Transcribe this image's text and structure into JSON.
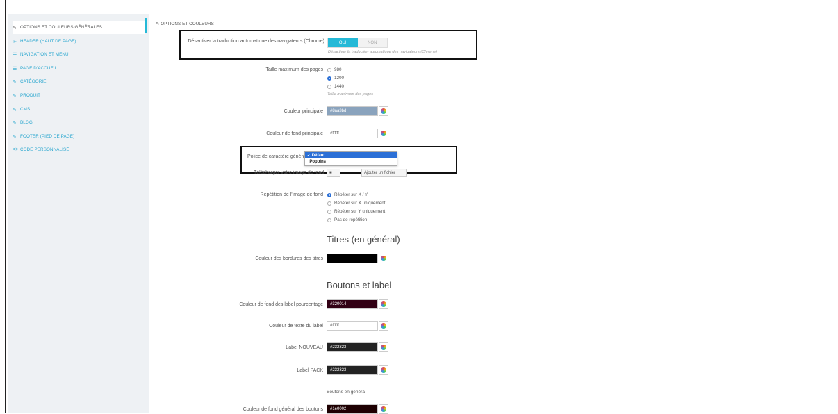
{
  "sidebar": {
    "items": [
      {
        "icon": "pencil-icon",
        "glyph": "✎",
        "label": "OPTIONS ET COULEURS GÉNÉRALES"
      },
      {
        "icon": "header-icon",
        "glyph": "⊩",
        "label": "HEADER (HAUT DE PAGE)"
      },
      {
        "icon": "menu-icon",
        "glyph": "☰",
        "label": "NAVIGATION ET MENU"
      },
      {
        "icon": "menu-icon",
        "glyph": "☰",
        "label": "PAGE D'ACCUEIL"
      },
      {
        "icon": "pencil-icon",
        "glyph": "✎",
        "label": "CATÉGORIE"
      },
      {
        "icon": "pencil-icon",
        "glyph": "✎",
        "label": "PRODUIT"
      },
      {
        "icon": "pencil-icon",
        "glyph": "✎",
        "label": "CMS"
      },
      {
        "icon": "pencil-icon",
        "glyph": "✎",
        "label": "BLOG"
      },
      {
        "icon": "pencil-icon",
        "glyph": "✎",
        "label": "FOOTER (PIED DE PAGE)"
      },
      {
        "icon": "code-icon",
        "glyph": "<>",
        "label": "CODE PERSONNALISÉ"
      }
    ]
  },
  "panel": {
    "header_icon": "✎",
    "header": "OPTIONS ET COULEURS"
  },
  "form": {
    "translation": {
      "label": "Désactiver la traduction automatique des navigateurs (Chrome)",
      "yes": "OUI",
      "no": "NON",
      "help": "Désactiver la traduction automatique des navigateurs (Chrome)"
    },
    "page_size": {
      "label": "Taille maximum des pages",
      "options": [
        "980",
        "1200",
        "1440"
      ],
      "help": "Taille maximum des pages"
    },
    "main_color": {
      "label": "Couleur principale",
      "value": "#8aa3bd"
    },
    "main_bg_color": {
      "label": "Couleur de fond principale",
      "value": "#ffffff"
    },
    "font": {
      "label": "Police de caractère générale du site",
      "options": [
        "Défaut",
        "Poppins"
      ],
      "checkmark": "✓"
    },
    "bg_image": {
      "label": "Télécharger votre image de fond",
      "add_label": "Ajouter un fichier"
    },
    "bg_repeat": {
      "label": "Répétition de l'image de fond",
      "options": [
        "Répéter sur X / Y",
        "Répéter sur X uniquement",
        "Répéter sur Y uniquement",
        "Pas de répétition"
      ]
    },
    "titles_section": "Titres (en général)",
    "title_border_color": {
      "label": "Couleur des bordures des titres",
      "value": ""
    },
    "buttons_section": "Boutons et label",
    "label_pct_bg": {
      "label": "Couleur de fond des label pourcentage",
      "value": "#320014"
    },
    "label_text_color": {
      "label": "Couleur de texte du label",
      "value": "#ffffff"
    },
    "label_new": {
      "label": "Label NOUVEAU",
      "value": "#232323"
    },
    "label_pack": {
      "label": "Label PACK",
      "value": "#232323"
    },
    "buttons_general_subhead": "Boutons en général",
    "btn_bg_color": {
      "label": "Couleur de fond général des boutons",
      "value": "#1e0002"
    }
  },
  "colors": {
    "accent": "#25b9d7",
    "main_swatch": "#8aa3bd",
    "title_border_swatch": "#000000",
    "label_pct_swatch": "#320014",
    "label_new_swatch": "#232323",
    "label_pack_swatch": "#232323",
    "btn_bg_swatch": "#1e0002"
  }
}
